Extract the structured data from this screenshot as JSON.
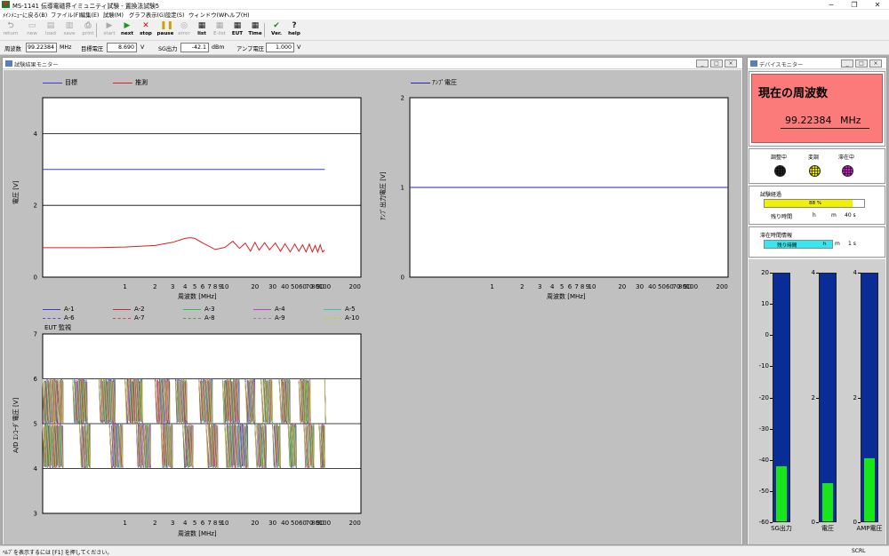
{
  "window": {
    "title": "MS-1141 伝導電磁界イミュニティ試験 - 置換法試験5",
    "controls": [
      "─",
      "❐",
      "✕"
    ]
  },
  "menu": [
    "ﾒｲﾝﾒﾆｭｰに戻る(B)",
    "ファイル(F)",
    "編集(E)",
    "試験(M)",
    "グラフ表示(G)",
    "設定(S)",
    "ウィンドウ(W)",
    "ヘルプ(H)"
  ],
  "toolbar": [
    {
      "label": "return",
      "icon": "return-icon",
      "enabled": false
    },
    {
      "label": "new",
      "icon": "new-icon",
      "enabled": false
    },
    {
      "label": "load",
      "icon": "load-icon",
      "enabled": false
    },
    {
      "label": "save",
      "icon": "save-icon",
      "enabled": false
    },
    {
      "label": "print",
      "icon": "print-icon",
      "enabled": false
    },
    {
      "label": "start",
      "icon": "start-icon",
      "enabled": false
    },
    {
      "label": "next",
      "icon": "next-icon",
      "enabled": true
    },
    {
      "label": "stop",
      "icon": "stop-icon",
      "enabled": true
    },
    {
      "label": "pause",
      "icon": "pause-icon",
      "enabled": true
    },
    {
      "label": "error",
      "icon": "error-icon",
      "enabled": false
    },
    {
      "label": "list",
      "icon": "list-icon",
      "enabled": true
    },
    {
      "label": "E-list",
      "icon": "e-list-icon",
      "enabled": false
    },
    {
      "label": "EUT",
      "icon": "eut-icon",
      "enabled": true
    },
    {
      "label": "Time",
      "icon": "time-icon",
      "enabled": true
    },
    {
      "label": "Ver.",
      "icon": "version-icon",
      "enabled": true
    },
    {
      "label": "help",
      "icon": "help-icon",
      "enabled": true
    }
  ],
  "fields": {
    "freq_label": "周波数",
    "freq_value": "99.22384",
    "freq_unit": "MHz",
    "target_label": "目標電圧",
    "target_value": "8.690",
    "target_unit": "V",
    "sg_label": "SG出力",
    "sg_value": "-42.1",
    "sg_unit": "dBm",
    "amp_label": "アンプ電圧",
    "amp_value": "1.000",
    "amp_unit": "V"
  },
  "monitor": {
    "title": "試験結果モニター",
    "top_left": {
      "legend": [
        {
          "name": "目標",
          "color": "#3b3bd6"
        },
        {
          "name": "推測",
          "color": "#d82020"
        }
      ],
      "ylabel": "電圧 [V]",
      "xlabel": "周波数 [MHz]"
    },
    "top_right": {
      "legend": [
        {
          "name": "ｱﾝﾌﾟ電圧",
          "color": "#2626b8"
        }
      ],
      "ylabel": "ｱﾝﾌﾟ出力電圧 [V]",
      "xlabel": "周波数 [MHz]"
    },
    "bottom": {
      "legend": [
        {
          "name": "A-1",
          "color": "#3a3ad8"
        },
        {
          "name": "A-2",
          "color": "#d22a2a"
        },
        {
          "name": "A-3",
          "color": "#25c83a"
        },
        {
          "name": "A-4",
          "color": "#c83ac8"
        },
        {
          "name": "A-5",
          "color": "#30c8b4"
        },
        {
          "name": "A-6",
          "color": "#5050d0"
        },
        {
          "name": "A-7",
          "color": "#c84848"
        },
        {
          "name": "A-8",
          "color": "#4a9a4a"
        },
        {
          "name": "A-9",
          "color": "#b070b0"
        },
        {
          "name": "A-10",
          "color": "#c8c840"
        }
      ],
      "subtitle": "EUT 監視",
      "ylabel": "A/D ｴﾝｺｰﾀﾞ電圧 [V]",
      "xlabel": "周波数 [MHz]"
    }
  },
  "device": {
    "title": "デバイスモニター",
    "freq_title": "現在の周波数",
    "freq_value": "99.22384",
    "freq_unit": "MHz",
    "lamps": [
      {
        "label": "調整中",
        "color": "#222222"
      },
      {
        "label": "変調",
        "color": "#e6e600"
      },
      {
        "label": "滞在中",
        "color": "#c020c0"
      }
    ],
    "progress_title": "試験経過",
    "progress_text": "88 %",
    "progress": 0.88,
    "remaining_label": "残り時間",
    "remaining_h": "h",
    "remaining_m": "m",
    "remaining_s": "40 s",
    "dwell_title": "滞在時間情報",
    "dwell_label": "残り時間",
    "dwell_h": "h",
    "dwell_m": "m",
    "dwell_s": "1 s",
    "dwell_progress": 1.0,
    "meters": [
      {
        "label": "SG出力",
        "ticks": [
          "20",
          "10",
          "0",
          "-10",
          "-20",
          "-30",
          "-40",
          "-50",
          "-60"
        ],
        "min": -60,
        "max": 20,
        "value": -42.1
      },
      {
        "label": "電圧",
        "ticks": [
          "4",
          "2",
          "0"
        ],
        "min": 0,
        "max": 4,
        "value": 0.62
      },
      {
        "label": "AMP電圧",
        "ticks": [
          "4",
          "2",
          "0"
        ],
        "min": 0,
        "max": 4,
        "value": 1.02
      }
    ]
  },
  "chart_data": [
    {
      "type": "line",
      "title": "",
      "xlabel": "周波数 [MHz]",
      "ylabel": "電圧 [V]",
      "xscale": "log",
      "xlim": [
        0.15,
        230
      ],
      "ylim": [
        0,
        5
      ],
      "yticks": [
        0,
        2,
        4
      ],
      "xticks": [
        "1",
        "2",
        "3",
        "4",
        "5",
        "6",
        "7",
        "8",
        "9",
        "10",
        "20",
        "30",
        "40",
        "50",
        "60",
        "70",
        "80",
        "90",
        "100",
        "200"
      ],
      "grid": "horizontal",
      "legend": "top",
      "series": [
        {
          "name": "目標",
          "color": "#3b3bd6",
          "x": [
            0.15,
            100
          ],
          "y": [
            3,
            3
          ]
        },
        {
          "name": "推測",
          "color": "#d82020",
          "x": [
            0.15,
            0.5,
            1,
            2,
            3,
            4,
            4.5,
            5,
            6,
            8,
            10,
            12,
            14,
            16,
            18,
            20,
            22,
            25,
            28,
            32,
            36,
            40,
            45,
            50,
            55,
            60,
            65,
            70,
            75,
            80,
            85,
            90,
            95,
            100
          ],
          "y": [
            0.82,
            0.82,
            0.84,
            0.88,
            0.97,
            1.08,
            1.1,
            1.08,
            0.95,
            0.77,
            0.83,
            1.0,
            0.8,
            0.95,
            0.72,
            0.97,
            0.75,
            0.96,
            0.76,
            0.95,
            0.72,
            0.93,
            0.7,
            0.92,
            0.72,
            0.9,
            0.7,
            0.92,
            0.7,
            0.88,
            0.7,
            0.9,
            0.7,
            0.75
          ]
        }
      ]
    },
    {
      "type": "line",
      "title": "",
      "xlabel": "周波数 [MHz]",
      "ylabel": "ｱﾝﾌﾟ出力電圧 [V]",
      "xscale": "log",
      "xlim": [
        0.15,
        230
      ],
      "ylim": [
        0,
        2
      ],
      "yticks": [
        0,
        1,
        2
      ],
      "xticks": [
        "1",
        "2",
        "3",
        "4",
        "5",
        "6",
        "7",
        "8",
        "9",
        "10",
        "20",
        "30",
        "40",
        "50",
        "60",
        "70",
        "80",
        "90",
        "100",
        "200"
      ],
      "legend": "top",
      "series": [
        {
          "name": "ｱﾝﾌﾟ電圧",
          "color": "#2626b8",
          "x": [
            0.15,
            230
          ],
          "y": [
            1,
            1
          ]
        }
      ]
    },
    {
      "type": "line",
      "title": "EUT 監視",
      "xlabel": "周波数 [MHz]",
      "ylabel": "A/D ｴﾝｺｰﾀﾞ電圧 [V]",
      "xscale": "log",
      "xlim": [
        0.15,
        230
      ],
      "ylim": [
        3,
        7
      ],
      "yticks": [
        3,
        4,
        5,
        6,
        7
      ],
      "xticks": [
        "1",
        "2",
        "3",
        "4",
        "5",
        "6",
        "7",
        "8",
        "9",
        "10",
        "20",
        "30",
        "40",
        "50",
        "60",
        "70",
        "80",
        "90",
        "100",
        "200"
      ],
      "grid": "horizontal",
      "legend": "top",
      "band_upper": [
        5,
        6
      ],
      "band_lower": [
        4,
        5
      ],
      "bursts_upper": [
        [
          0.15,
          0.24
        ],
        [
          0.3,
          0.42
        ],
        [
          0.55,
          0.8
        ],
        [
          1.0,
          1.5
        ],
        [
          2.0,
          2.8
        ],
        [
          3.2,
          4.2
        ],
        [
          5.5,
          7.5
        ],
        [
          9.5,
          14
        ],
        [
          16,
          20
        ],
        [
          23,
          30
        ],
        [
          35,
          45
        ],
        [
          55,
          72
        ],
        [
          100,
          102
        ]
      ],
      "bursts_lower": [
        [
          0.15,
          0.24
        ],
        [
          0.35,
          0.45
        ],
        [
          0.7,
          0.95
        ],
        [
          1.3,
          1.8
        ],
        [
          2.3,
          3.0
        ],
        [
          3.8,
          4.8
        ],
        [
          6.5,
          8.5
        ],
        [
          10,
          17
        ],
        [
          20,
          26
        ],
        [
          30,
          36
        ],
        [
          43,
          52
        ],
        [
          62,
          78
        ],
        [
          88,
          100
        ]
      ],
      "series": [
        "A-1",
        "A-2",
        "A-3",
        "A-4",
        "A-5",
        "A-6",
        "A-7",
        "A-8",
        "A-9",
        "A-10"
      ]
    }
  ],
  "statusbar": {
    "hint": "ﾍﾙﾌﾟを表示するには [F1] を押してください。",
    "mode": "SCRL"
  }
}
